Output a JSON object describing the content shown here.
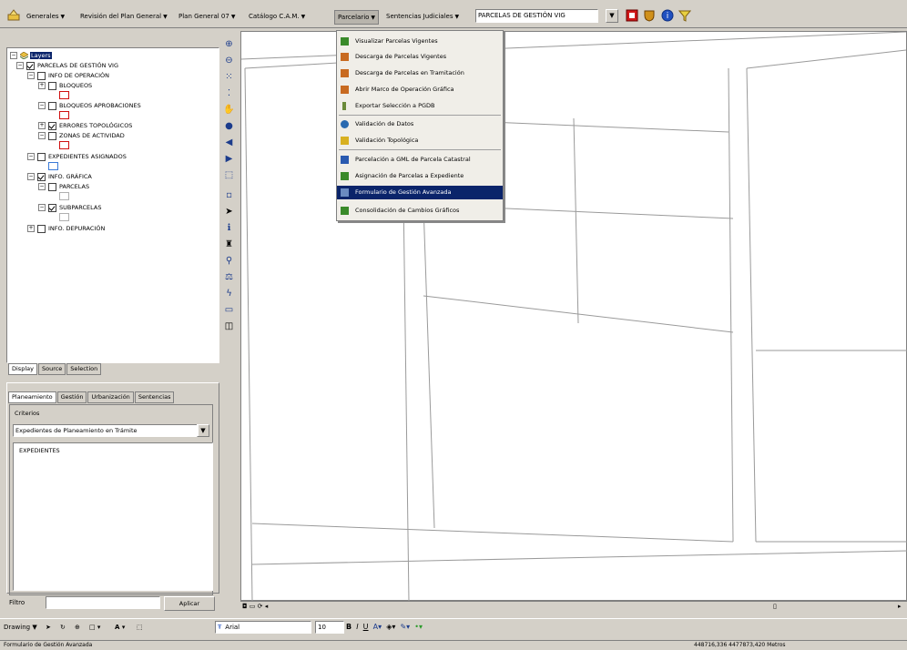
{
  "toolbar": {
    "menus": [
      {
        "label": "Generales"
      },
      {
        "label": "Revisión del Plan General"
      },
      {
        "label": "Plan General 07"
      },
      {
        "label": "Catálogo C.A.M."
      },
      {
        "label": "Parcelario"
      },
      {
        "label": "Sentencias Judiciales"
      }
    ],
    "layer_combo": "PARCELAS DE GESTIÓN VIG",
    "icons": [
      "pencil-icon",
      "stop-icon",
      "shield-icon",
      "help-icon",
      "funnel-icon"
    ]
  },
  "parcelario_menu": {
    "items": [
      {
        "label": "Visualizar Parcelas Vigentes",
        "icon": "view-icon",
        "color": "#3a8a2a"
      },
      {
        "label": "Descarga de Parcelas Vigentes",
        "icon": "download-icon",
        "color": "#c86a20"
      },
      {
        "label": "Descarga de Parcelas en Tramitación",
        "icon": "download-icon",
        "color": "#c86a20"
      },
      {
        "label": "Abrir Marco de Operación Gráfica",
        "icon": "frame-icon",
        "color": "#c86a20"
      },
      {
        "label": "Exportar Selección a PGDB",
        "icon": "export-icon",
        "color": "#6a8a3a"
      },
      {
        "label": "Validación de Datos",
        "icon": "globe-icon",
        "color": "#2a6ab0"
      },
      {
        "label": "Validación Topológica",
        "icon": "topology-icon",
        "color": "#d8b020"
      },
      {
        "label": "Parcelación a GML de Parcela Catastral",
        "icon": "gml-icon",
        "color": "#2a5ab0"
      },
      {
        "label": "Asignación de Parcelas a Expediente",
        "icon": "assign-icon",
        "color": "#3a8a2a"
      },
      {
        "label": "Formulario de Gestión Avanzada",
        "icon": "form-icon",
        "color": "#6a8ac0"
      },
      {
        "label": "Consolidación de Cambios Gráficos",
        "icon": "consolidate-icon",
        "color": "#3a8a2a"
      }
    ],
    "selected_index": 9
  },
  "layers": {
    "root": "Layers",
    "items": [
      {
        "label": "PARCELAS DE GESTIÓN VIG",
        "checked": true
      },
      {
        "label": "INFO DE OPERACIÓN",
        "checked": false
      },
      {
        "label": "BLOQUEOS",
        "checked": false
      },
      {
        "label": "BLOQUEOS APROBACIONES",
        "checked": false
      },
      {
        "label": "ERRORES TOPOLÓGICOS",
        "checked": true
      },
      {
        "label": "ZONAS DE ACTIVIDAD",
        "checked": false
      },
      {
        "label": "EXPEDIENTES ASIGNADOS",
        "checked": false
      },
      {
        "label": "INFO. GRÁFICA",
        "checked": true
      },
      {
        "label": "PARCELAS",
        "checked": false
      },
      {
        "label": "SUBPARCELAS",
        "checked": true
      },
      {
        "label": "INFO. DEPURACIÓN",
        "checked": false
      }
    ],
    "tabs": [
      "Display",
      "Source",
      "Selection"
    ]
  },
  "lower_panel": {
    "tabs": [
      "Planeamiento",
      "Gestión",
      "Urbanización",
      "Sentencias"
    ],
    "criterios_label": "Criterios",
    "select_value": "Expedientes de Planeamiento en Trámite",
    "list_header": "EXPEDIENTES",
    "filtro_label": "Filtro",
    "filtro_value": "",
    "aplicar_label": "Aplicar"
  },
  "drawbar": {
    "drawing_label": "Drawing",
    "font_name": "Arial",
    "font_size": "10"
  },
  "status": {
    "left": "Formulario de Gestión Avanzada",
    "right": "448716,336 4477873,420 Metros"
  },
  "colors": {
    "menu_highlight": "#0a246a",
    "swatch_red": "#d01010",
    "swatch_blue": "#3a7ad8"
  }
}
